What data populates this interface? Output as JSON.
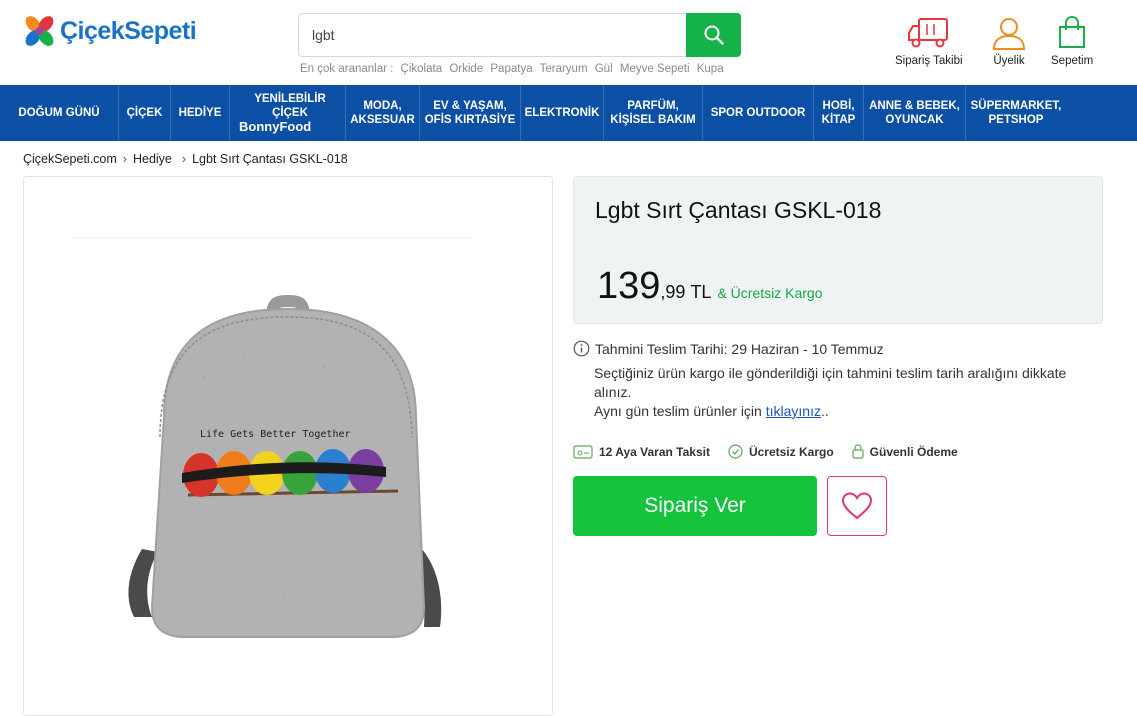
{
  "header": {
    "logo_text": "ÇiçekSepeti",
    "search": {
      "value": "lgbt",
      "placeholder": ""
    },
    "popular_label": "En çok arananlar :",
    "popular_terms": [
      "Çikolata",
      "Orkide",
      "Papatya",
      "Teraryum",
      "Gül",
      "Meyve Sepeti",
      "Kupa"
    ],
    "actions": {
      "order_tracking": "Sipariş Takibi",
      "membership": "Üyelik",
      "cart": "Sepetim"
    }
  },
  "nav": {
    "items": [
      {
        "line1": "DOĞUM GÜNÜ",
        "line2": ""
      },
      {
        "line1": "ÇİÇEK",
        "line2": ""
      },
      {
        "line1": "HEDİYE",
        "line2": ""
      },
      {
        "line1": "YENİLEBİLİR ÇİÇEK",
        "line2": "BonnyFood"
      },
      {
        "line1": "MODA,",
        "line2": "AKSESUAR"
      },
      {
        "line1": "EV & YAŞAM,",
        "line2": "OFİS KIRTASİYE"
      },
      {
        "line1": "ELEKTRONİK",
        "line2": ""
      },
      {
        "line1": "PARFÜM,",
        "line2": "KİŞİSEL BAKIM"
      },
      {
        "line1": "SPOR OUTDOOR",
        "line2": ""
      },
      {
        "line1": "HOBİ,",
        "line2": "KİTAP"
      },
      {
        "line1": "ANNE & BEBEK,",
        "line2": "OYUNCAK"
      },
      {
        "line1": "SÜPERMARKET,",
        "line2": "PETSHOP"
      }
    ]
  },
  "breadcrumb": [
    "ÇiçekSepeti.com",
    "Hediye",
    "Lgbt Sırt Çantası GSKL-018"
  ],
  "product": {
    "title": "Lgbt Sırt Çantası GSKL-018",
    "image_text": "Life Gets Better Together",
    "price_int": "139",
    "price_dec": ",99",
    "currency": "TL",
    "free_shipping": "& Ücretsiz Kargo",
    "delivery_label": "Tahmini Teslim Tarihi: 29 Haziran - 10 Temmuz",
    "delivery_note": "Seçtiğiniz ürün kargo ile gönderildiği için tahmini teslim tarih aralığını dikkate alınız.",
    "same_day_text": "Aynı gün teslim ürünler için",
    "same_day_link": "tıklayınız",
    "same_day_suffix": "..",
    "badges": [
      "12 Aya Varan Taksit",
      "Ücretsiz Kargo",
      "Güvenli Ödeme"
    ],
    "order_button": "Sipariş Ver"
  },
  "colors": {
    "brand_blue": "#0c50a5",
    "green": "#15c23c",
    "favorite_pink": "#e2376b",
    "cart_green": "#15b24a",
    "order_icon_red": "#e2373d",
    "user_icon_orange": "#f28a1d"
  },
  "icons": {
    "search": "search-icon",
    "order_tracking": "truck-icon",
    "membership": "user-icon",
    "cart": "shopping-bag-icon",
    "favorite": "heart-icon",
    "info": "info-icon"
  }
}
